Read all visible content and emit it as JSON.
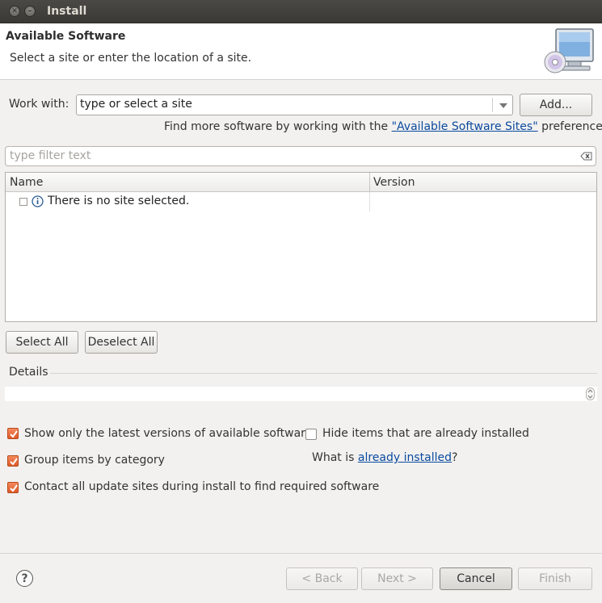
{
  "window": {
    "title": "Install"
  },
  "banner": {
    "title": "Available Software",
    "description": "Select a site or enter the location of a site.",
    "icon": "monitor-cd-icon"
  },
  "work_with": {
    "label": "Work with:",
    "value": "type or select a site",
    "add_button": "Add...",
    "hint_prefix": "Find more software by working with the ",
    "hint_link": "\"Available Software Sites\"",
    "hint_suffix": " preferences."
  },
  "filter": {
    "placeholder": "type filter text"
  },
  "table": {
    "columns": [
      "Name",
      "Version"
    ],
    "rows": [
      {
        "checked": false,
        "icon": "info-icon",
        "name": "There is no site selected.",
        "version": ""
      }
    ]
  },
  "selection_buttons": {
    "select_all": "Select All",
    "deselect_all": "Deselect All"
  },
  "details": {
    "label": "Details",
    "text": ""
  },
  "options": {
    "latest_versions": {
      "label": "Show only the latest versions of available software",
      "checked": true
    },
    "hide_installed": {
      "label": "Hide items that are already installed",
      "checked": false
    },
    "group_by_category": {
      "label": "Group items by category",
      "checked": true
    },
    "contact_sites": {
      "label": "Contact all update sites during install to find required software",
      "checked": true
    },
    "what_is_prefix": "What is ",
    "what_is_link": "already installed",
    "what_is_suffix": "?"
  },
  "footer": {
    "help": "?",
    "back": "< Back",
    "next": "Next >",
    "cancel": "Cancel",
    "finish": "Finish"
  },
  "colors": {
    "checkbox_on": "#de5a27",
    "link": "#0b4a9e",
    "titlebar": "#3c3b37"
  }
}
